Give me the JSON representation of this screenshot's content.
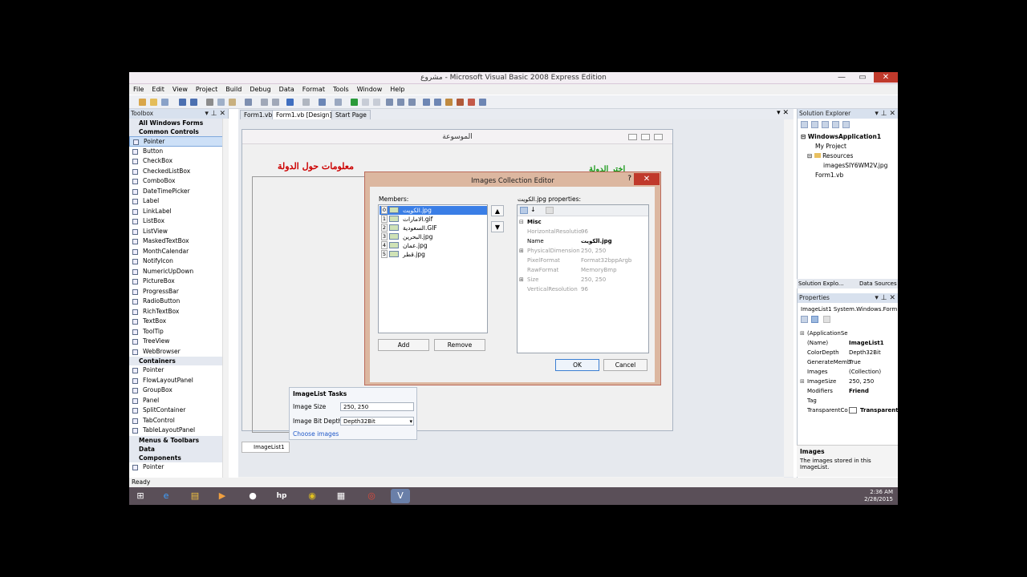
{
  "window": {
    "title": "مشروع - Microsoft Visual Basic 2008 Express Edition",
    "controls": [
      "—",
      "▭",
      "✕"
    ]
  },
  "menu": [
    "File",
    "Edit",
    "View",
    "Project",
    "Build",
    "Debug",
    "Data",
    "Format",
    "Tools",
    "Window",
    "Help"
  ],
  "toolbox": {
    "title": "Toolbox",
    "categories": {
      "all": "All Windows Forms",
      "common": "Common Controls",
      "containers": "Containers",
      "menus": "Menus & Toolbars",
      "data": "Data",
      "components": "Components"
    },
    "common_items": [
      "Pointer",
      "Button",
      "CheckBox",
      "CheckedListBox",
      "ComboBox",
      "DateTimePicker",
      "Label",
      "LinkLabel",
      "ListBox",
      "ListView",
      "MaskedTextBox",
      "MonthCalendar",
      "NotifyIcon",
      "NumericUpDown",
      "PictureBox",
      "ProgressBar",
      "RadioButton",
      "RichTextBox",
      "TextBox",
      "ToolTip",
      "TreeView",
      "WebBrowser"
    ],
    "container_items": [
      "Pointer",
      "FlowLayoutPanel",
      "GroupBox",
      "Panel",
      "SplitContainer",
      "TabControl",
      "TableLayoutPanel"
    ],
    "last_item": "Pointer"
  },
  "tabs": [
    "Form1.vb*",
    "Form1.vb [Design]*",
    "Start Page"
  ],
  "form": {
    "title": "الموسوعة",
    "red_text": "معلومات حول الدولة",
    "green_text": "اختر الدولة"
  },
  "tasks": {
    "header": "ImageList Tasks",
    "size_label": "Image Size",
    "size_value": "250, 250",
    "depth_label": "Image Bit Depth",
    "depth_value": "Depth32Bit",
    "link": "Choose images"
  },
  "imagelist": "ImageList1",
  "dialog": {
    "title": "Images Collection Editor",
    "help": "?",
    "close": "✕",
    "members_label": "Members:",
    "members": [
      {
        "n": "0",
        "name": "الكويت.jpg"
      },
      {
        "n": "1",
        "name": "الامارات.gif"
      },
      {
        "n": "2",
        "name": "السعودية.GIF"
      },
      {
        "n": "3",
        "name": "البحرين.jpg"
      },
      {
        "n": "4",
        "name": "عمان.jpg"
      },
      {
        "n": "5",
        "name": "قطر.jpg"
      }
    ],
    "up": "▲",
    "down": "▼",
    "add": "Add",
    "remove": "Remove",
    "props_label": "الكويت.jpg properties:",
    "misc": "Misc",
    "props": [
      {
        "exp": "",
        "k": "HorizontalResolutio",
        "v": "96"
      },
      {
        "exp": "",
        "k": "Name",
        "v": "الكويت.jpg"
      },
      {
        "exp": "⊞",
        "k": "PhysicalDimension",
        "v": "250, 250"
      },
      {
        "exp": "",
        "k": "PixelFormat",
        "v": "Format32bppArgb"
      },
      {
        "exp": "",
        "k": "RawFormat",
        "v": "MemoryBmp"
      },
      {
        "exp": "⊞",
        "k": "Size",
        "v": "250, 250"
      },
      {
        "exp": "",
        "k": "VerticalResolution",
        "v": "96"
      }
    ],
    "ok": "OK",
    "cancel": "Cancel"
  },
  "solution": {
    "title": "Solution Explorer",
    "root": "WindowsApplication1",
    "items": [
      "My Project",
      "Resources",
      "imagesSIY6WM2V.jpg",
      "Form1.vb"
    ],
    "tab1": "Solution Explo...",
    "tab2": "Data Sources"
  },
  "properties": {
    "title": "Properties",
    "object": "ImageList1  System.Windows.Form",
    "rows": [
      {
        "e": "⊞",
        "k": "(ApplicationSe",
        "v": ""
      },
      {
        "e": "",
        "k": "(Name)",
        "v": "ImageList1"
      },
      {
        "e": "",
        "k": "ColorDepth",
        "v": "Depth32Bit"
      },
      {
        "e": "",
        "k": "GenerateMemb",
        "v": "True"
      },
      {
        "e": "",
        "k": "Images",
        "v": "(Collection)"
      },
      {
        "e": "⊞",
        "k": "ImageSize",
        "v": "250, 250"
      },
      {
        "e": "",
        "k": "Modifiers",
        "v": "Friend"
      },
      {
        "e": "",
        "k": "Tag",
        "v": ""
      },
      {
        "e": "",
        "k": "TransparentCo",
        "v": "Transparent"
      }
    ],
    "desc_title": "Images",
    "desc_text": "The images stored in this ImageList."
  },
  "status": "Ready",
  "clock": {
    "time": "2:36 AM",
    "date": "2/28/2015"
  },
  "taskbar_icons": [
    "⊞",
    "e",
    "▤",
    "▶",
    "●",
    "hp",
    "◉",
    "▦",
    "◎",
    "V"
  ]
}
